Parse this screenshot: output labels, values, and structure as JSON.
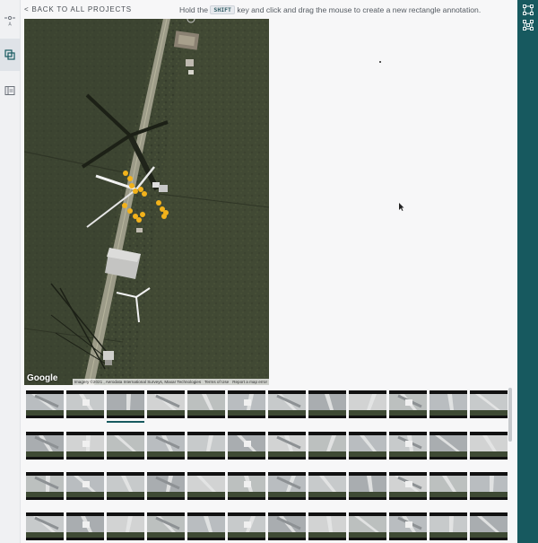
{
  "nav": {
    "back_label": "< BACK TO ALL PROJECTS"
  },
  "hint": {
    "before": "Hold the",
    "key": "SHIFT",
    "after": "key and click and drag the mouse to create a new rectangle annotation."
  },
  "left_rail": [
    {
      "icon": "text-annotation-icon",
      "active": false
    },
    {
      "icon": "layers-icon",
      "active": true
    },
    {
      "icon": "panel-icon",
      "active": false
    }
  ],
  "right_rail": [
    {
      "icon": "bounding-box-icon"
    },
    {
      "icon": "polygon-icon"
    }
  ],
  "map": {
    "logo": "Google",
    "credits": {
      "imagery": "Imagery ©2021 , Aerodata International Surveys, Maxar Technologies",
      "terms": "Terms of Use",
      "report": "Report a map error"
    }
  },
  "thumbnails": {
    "rows": 4,
    "cols": 12,
    "selected_index": 2
  },
  "colors": {
    "accent": "#17595f",
    "annotation": "#f2b21b"
  }
}
